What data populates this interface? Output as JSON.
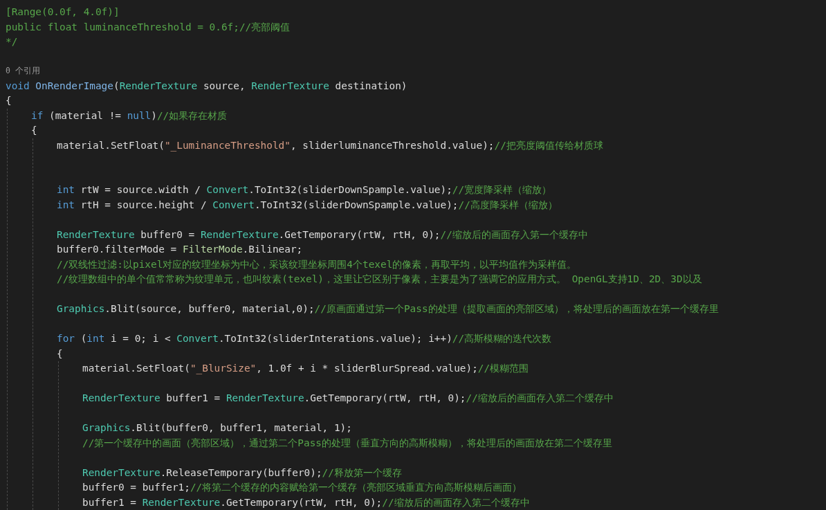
{
  "editor": {
    "lines": [
      {
        "kind": "code",
        "segments": [
          {
            "text": "[Range(0.0f, 4.0f)]",
            "kind": "comment"
          }
        ]
      },
      {
        "kind": "code",
        "segments": [
          {
            "text": "public float luminanceThreshold = 0.6f;//亮部阈值",
            "kind": "comment"
          }
        ]
      },
      {
        "kind": "code",
        "segments": [
          {
            "text": "*/",
            "kind": "comment"
          }
        ]
      },
      {
        "kind": "blank"
      },
      {
        "kind": "codelens",
        "text": "0 个引用"
      },
      {
        "kind": "code",
        "segments": [
          {
            "text": "void",
            "kind": "keyword"
          },
          {
            "text": " OnRenderImage",
            "kind": "method"
          },
          {
            "text": "(",
            "kind": "plain"
          },
          {
            "text": "RenderTexture",
            "kind": "type"
          },
          {
            "text": " source, ",
            "kind": "plain"
          },
          {
            "text": "RenderTexture",
            "kind": "type"
          },
          {
            "text": " destination)",
            "kind": "plain"
          }
        ]
      },
      {
        "kind": "code",
        "segments": [
          {
            "text": "{",
            "kind": "plain"
          }
        ]
      },
      {
        "kind": "block",
        "children": [
          {
            "kind": "code",
            "segments": [
              {
                "text": "if",
                "kind": "keyword"
              },
              {
                "text": " (material != ",
                "kind": "plain"
              },
              {
                "text": "null",
                "kind": "keyword"
              },
              {
                "text": ")",
                "kind": "plain"
              },
              {
                "text": "//如果存在材质",
                "kind": "comment"
              }
            ]
          },
          {
            "kind": "code",
            "segments": [
              {
                "text": "{",
                "kind": "plain"
              }
            ]
          },
          {
            "kind": "block",
            "children": [
              {
                "kind": "code",
                "segments": [
                  {
                    "text": "material.SetFloat(",
                    "kind": "plain"
                  },
                  {
                    "text": "\"_LuminanceThreshold\"",
                    "kind": "string"
                  },
                  {
                    "text": ", sliderluminanceThreshold.value);",
                    "kind": "plain"
                  },
                  {
                    "text": "//把亮度阈值传给材质球",
                    "kind": "comment"
                  }
                ]
              },
              {
                "kind": "blank"
              },
              {
                "kind": "blank"
              },
              {
                "kind": "code",
                "segments": [
                  {
                    "text": "int",
                    "kind": "keyword"
                  },
                  {
                    "text": " rtW = source.width / ",
                    "kind": "plain"
                  },
                  {
                    "text": "Convert",
                    "kind": "type"
                  },
                  {
                    "text": ".ToInt32(sliderDownSpample.value);",
                    "kind": "plain"
                  },
                  {
                    "text": "//宽度降采样（缩放）",
                    "kind": "comment"
                  }
                ]
              },
              {
                "kind": "code",
                "segments": [
                  {
                    "text": "int",
                    "kind": "keyword"
                  },
                  {
                    "text": " rtH = source.height / ",
                    "kind": "plain"
                  },
                  {
                    "text": "Convert",
                    "kind": "type"
                  },
                  {
                    "text": ".ToInt32(sliderDownSpample.value);",
                    "kind": "plain"
                  },
                  {
                    "text": "//高度降采样（缩放）",
                    "kind": "comment"
                  }
                ]
              },
              {
                "kind": "blank"
              },
              {
                "kind": "code",
                "segments": [
                  {
                    "text": "RenderTexture",
                    "kind": "type"
                  },
                  {
                    "text": " buffer0 = ",
                    "kind": "plain"
                  },
                  {
                    "text": "RenderTexture",
                    "kind": "type"
                  },
                  {
                    "text": ".GetTemporary(rtW, rtH, 0);",
                    "kind": "plain"
                  },
                  {
                    "text": "//缩放后的画面存入第一个缓存中",
                    "kind": "comment"
                  }
                ]
              },
              {
                "kind": "code",
                "segments": [
                  {
                    "text": "buffer0.filterMode = ",
                    "kind": "plain"
                  },
                  {
                    "text": "FilterMode",
                    "kind": "enum"
                  },
                  {
                    "text": ".Bilinear;",
                    "kind": "plain"
                  }
                ]
              },
              {
                "kind": "code",
                "segments": [
                  {
                    "text": "//双线性过滤:以pixel对应的纹理坐标为中心，采该纹理坐标周围4个texel的像素，再取平均，以平均值作为采样值。",
                    "kind": "comment"
                  }
                ]
              },
              {
                "kind": "code",
                "segments": [
                  {
                    "text": "//纹理数组中的单个值常常称为纹理单元，也叫纹素(texel)，这里让它区别于像素，主要是为了强调它的应用方式。 OpenGL支持1D、2D、3D以及",
                    "kind": "comment"
                  }
                ]
              },
              {
                "kind": "blank"
              },
              {
                "kind": "code",
                "segments": [
                  {
                    "text": "Graphics",
                    "kind": "type"
                  },
                  {
                    "text": ".Blit(source, buffer0, material,0);",
                    "kind": "plain"
                  },
                  {
                    "text": "//原画面通过第一个Pass的处理（提取画面的亮部区域），将处理后的画面放在第一个缓存里",
                    "kind": "comment"
                  }
                ]
              },
              {
                "kind": "blank"
              },
              {
                "kind": "code",
                "segments": [
                  {
                    "text": "for",
                    "kind": "keyword"
                  },
                  {
                    "text": " (",
                    "kind": "plain"
                  },
                  {
                    "text": "int",
                    "kind": "keyword"
                  },
                  {
                    "text": " i = 0; i < ",
                    "kind": "plain"
                  },
                  {
                    "text": "Convert",
                    "kind": "type"
                  },
                  {
                    "text": ".ToInt32(sliderInterations.value); i++)",
                    "kind": "plain"
                  },
                  {
                    "text": "//高斯模糊的迭代次数",
                    "kind": "comment"
                  }
                ]
              },
              {
                "kind": "code",
                "segments": [
                  {
                    "text": "{",
                    "kind": "plain"
                  }
                ]
              },
              {
                "kind": "block",
                "children": [
                  {
                    "kind": "code",
                    "segments": [
                      {
                        "text": "material.SetFloat(",
                        "kind": "plain"
                      },
                      {
                        "text": "\"_BlurSize\"",
                        "kind": "string"
                      },
                      {
                        "text": ", 1.0f + i * sliderBlurSpread.value);",
                        "kind": "plain"
                      },
                      {
                        "text": "//模糊范围",
                        "kind": "comment"
                      }
                    ]
                  },
                  {
                    "kind": "blank"
                  },
                  {
                    "kind": "code",
                    "segments": [
                      {
                        "text": "RenderTexture",
                        "kind": "type"
                      },
                      {
                        "text": " buffer1 = ",
                        "kind": "plain"
                      },
                      {
                        "text": "RenderTexture",
                        "kind": "type"
                      },
                      {
                        "text": ".GetTemporary(rtW, rtH, 0);",
                        "kind": "plain"
                      },
                      {
                        "text": "//缩放后的画面存入第二个缓存中",
                        "kind": "comment"
                      }
                    ]
                  },
                  {
                    "kind": "blank"
                  },
                  {
                    "kind": "code",
                    "segments": [
                      {
                        "text": "Graphics",
                        "kind": "type"
                      },
                      {
                        "text": ".Blit(buffer0, buffer1, material, 1);",
                        "kind": "plain"
                      }
                    ]
                  },
                  {
                    "kind": "code",
                    "segments": [
                      {
                        "text": "//第一个缓存中的画面（亮部区域），通过第二个Pass的处理（垂直方向的高斯模糊），将处理后的画面放在第二个缓存里",
                        "kind": "comment"
                      }
                    ]
                  },
                  {
                    "kind": "blank"
                  },
                  {
                    "kind": "code",
                    "segments": [
                      {
                        "text": "RenderTexture",
                        "kind": "type"
                      },
                      {
                        "text": ".ReleaseTemporary(buffer0);",
                        "kind": "plain"
                      },
                      {
                        "text": "//释放第一个缓存",
                        "kind": "comment"
                      }
                    ]
                  },
                  {
                    "kind": "code",
                    "segments": [
                      {
                        "text": "buffer0 = buffer1;",
                        "kind": "plain"
                      },
                      {
                        "text": "//将第二个缓存的内容赋给第一个缓存（亮部区域垂直方向高斯模糊后画面）",
                        "kind": "comment"
                      }
                    ]
                  },
                  {
                    "kind": "code",
                    "segments": [
                      {
                        "text": "buffer1 = ",
                        "kind": "plain"
                      },
                      {
                        "text": "RenderTexture",
                        "kind": "type"
                      },
                      {
                        "text": ".GetTemporary(rtW, rtH, 0);",
                        "kind": "plain"
                      },
                      {
                        "text": "//缩放后的画面存入第二个缓存中",
                        "kind": "comment"
                      }
                    ]
                  }
                ]
              }
            ]
          }
        ]
      }
    ]
  }
}
